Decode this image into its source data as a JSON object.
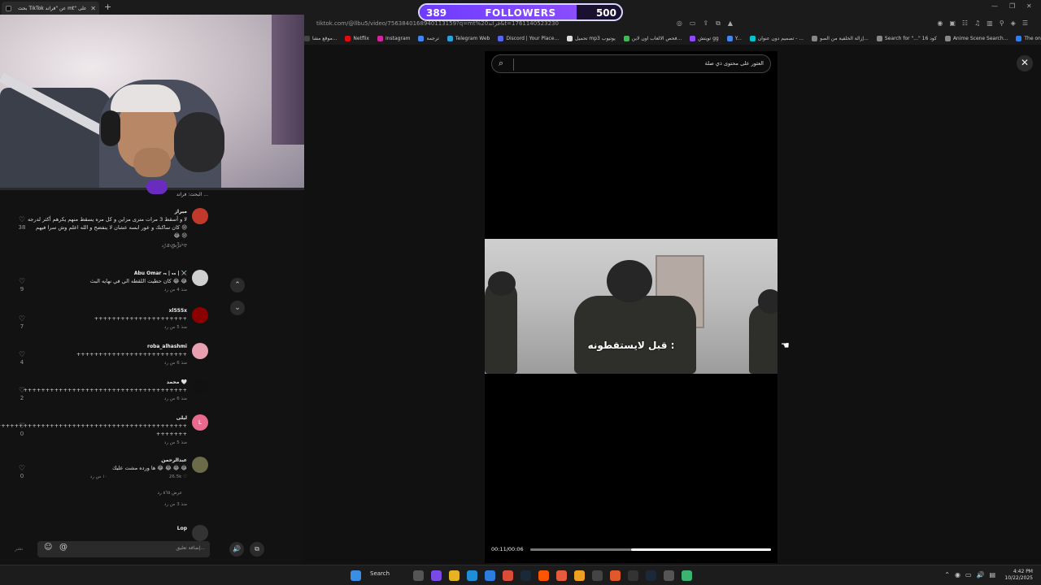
{
  "browser": {
    "tab_title": "بحث TikTok عن \"فراتد mt\" على",
    "url": "tiktok.com/@llbu5/video/7563840168940113159?q=mt%20فراتد&t=1761140523230",
    "bookmarks": [
      {
        "label": "موقع مشا...",
        "color": "#444444"
      },
      {
        "label": "Netflix",
        "color": "#e50914"
      },
      {
        "label": "Instagram",
        "color": "#d6249f"
      },
      {
        "label": "ترجمة",
        "color": "#4285f4"
      },
      {
        "label": "Telegram Web",
        "color": "#2aa1da"
      },
      {
        "label": "Discord | Your Place...",
        "color": "#5865f2"
      },
      {
        "label": "تحميل mp3 يوتيوب",
        "color": "#dddddd"
      },
      {
        "label": "فحص الالعاب اون لاين...",
        "color": "#3cba54"
      },
      {
        "label": "تويتش gg",
        "color": "#9146ff"
      },
      {
        "label": "Y...",
        "color": "#4285f4"
      },
      {
        "label": "تصميم دون عنوان - ...",
        "color": "#00c4cc"
      },
      {
        "label": "إزالة الخلفية من الصو...",
        "color": "#888888"
      },
      {
        "label": "Search for \"...\" 16 كود",
        "color": "#888888"
      },
      {
        "label": "Anime Scene Search...",
        "color": "#888888"
      },
      {
        "label": "The online code edi...",
        "color": "#2d7ff9"
      }
    ]
  },
  "followers": {
    "current": "389",
    "label": "FOLLOWERS",
    "goal": "500",
    "progress_fraction": 0.778
  },
  "comments": {
    "header": "البحث: فراتد ...",
    "items": [
      {
        "name": "ميراز",
        "text_lines": [
          "لا و أسقط 3 مرات مترى مزاين و كل مره يسقط منهم يكرهم أكثر لدرجه",
          "كان ساكنك و عور ابسه عشان لا ينفضح و الله اعلم وش سرا فيهم 😢",
          "😂 😢"
        ],
        "meta": "منذ 3 س   رد",
        "likes": "38",
        "more": "عرض 2 رد ⌄",
        "avatar_color": "#c0392b"
      },
      {
        "name": "Abu Omar ᵣₛ | ₛₐ | ⚔️",
        "text_lines": [
          "كان حطيت اللقطه الي في نهايه البث 😂 😂"
        ],
        "meta": "منذ 4 س   رد",
        "likes": "9",
        "avatar_color": "#cfcfcf"
      },
      {
        "name": "xl555x",
        "text_lines": [
          "+++++++++++++++++++++"
        ],
        "meta": "منذ 5 س   رد",
        "likes": "7",
        "avatar_color": "#8b0000"
      },
      {
        "name": "roba_alhashmi",
        "text_lines": [
          "+++++++++++++++++++++++++"
        ],
        "meta": "منذ 6 س   رد",
        "likes": "4",
        "avatar_color": "#e8a0b0"
      },
      {
        "name": "محمد 🤍",
        "text_lines": [
          "+++++++++++++++++++++++++++++++++++++"
        ],
        "meta": "منذ 6 س   رد",
        "likes": "2",
        "avatar_color": "#111111"
      },
      {
        "name": "ليلى",
        "text_lines": [
          "+++++++++++++++++++++++++++++++++++++++++++++++++++",
          "+++++++"
        ],
        "meta": "منذ 5 س   رد",
        "likes": "0",
        "avatar_color": "#e86a8f",
        "avatar_letter": "L"
      },
      {
        "name": "عبدالرحمن",
        "text_lines": [
          "ها ورده مشت عليك 😂 😂 😂 😂"
        ],
        "meta": "26.5k ♡",
        "meta2": "١٠ س  رد",
        "likes": "0",
        "more": "عرض ٨٦٥ رد",
        "meta3": "منذ 3 س   رد",
        "avatar_color": "#6b6b4a"
      },
      {
        "name": "Lop",
        "text_lines": [],
        "meta": "",
        "likes": "",
        "avatar_color": "#333333"
      }
    ]
  },
  "comment_input": {
    "placeholder": "إضافة تعليق...",
    "post_label": "نشر",
    "at_symbol": "@",
    "emoji_symbol": "☺"
  },
  "video": {
    "search_text": "العثور على محتوى ذي صلة",
    "subtitle": "قبل لايستقطونه :",
    "time": "00:11/00:06",
    "played_fraction": 0.42,
    "buffer_fraction": 0.58,
    "close_label": "✕",
    "search_icon": "⌕"
  },
  "nav": {
    "up": "⌃",
    "down": "⌄",
    "volume": "🔊",
    "caption": "⧉"
  },
  "taskbar": {
    "search_label": "Search",
    "time": "4:42 PM",
    "date": "10/22/2025"
  }
}
